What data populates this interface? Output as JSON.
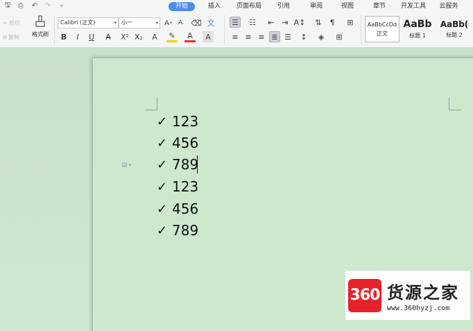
{
  "tabs": [
    {
      "label": "开始",
      "active": true
    },
    {
      "label": "插入"
    },
    {
      "label": "页面布局"
    },
    {
      "label": "引用"
    },
    {
      "label": "审阅"
    },
    {
      "label": "视图"
    },
    {
      "label": "章节"
    },
    {
      "label": "开发工具"
    },
    {
      "label": "云服务"
    }
  ],
  "clipboard": {
    "cut_label": "剪切",
    "copy_label": "复制",
    "painter_label": "格式刷"
  },
  "font": {
    "name": "Calibri (正文)",
    "size": "小一"
  },
  "styles": [
    {
      "sample": "AaBbCcDd",
      "name": "正文",
      "selected": true
    },
    {
      "sample": "AaBb",
      "name": "标题 1"
    },
    {
      "sample": "AaBb(",
      "name": "标题 2"
    }
  ],
  "document": {
    "lines": [
      "123",
      "456",
      "789",
      "123",
      "456",
      "789"
    ],
    "bullet_glyph": "✓"
  },
  "watermark": {
    "logo": "360",
    "name": "货源之家",
    "url": "www.360hyzj.com"
  },
  "colors": {
    "accent": "#4a8ee8",
    "page": "#cde8cd",
    "highlight": "#f5d000",
    "font_color": "#e03030"
  }
}
